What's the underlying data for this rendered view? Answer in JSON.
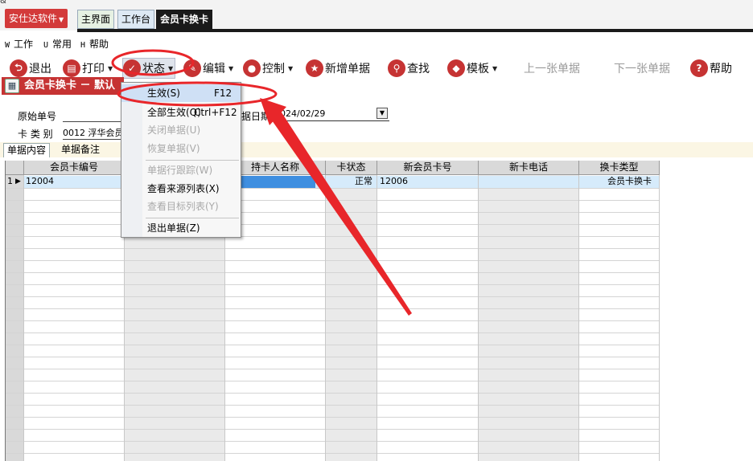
{
  "top_glyph": "&",
  "app_menu": {
    "label": "安仕达软件"
  },
  "tabs": [
    {
      "label": "主界面"
    },
    {
      "label": "工作台"
    },
    {
      "label": "会员卡换卡"
    }
  ],
  "menubar": [
    {
      "key": "W",
      "label": "工作"
    },
    {
      "key": "U",
      "label": "常用"
    },
    {
      "key": "H",
      "label": "帮助"
    }
  ],
  "toolbar": {
    "exit": "退出",
    "print": "打印",
    "status": "状态",
    "edit": "编辑",
    "control": "控制",
    "new_doc": "新增单据",
    "find": "查找",
    "template": "模板",
    "prev": "上一张单据",
    "next": "下一张单据",
    "help": "帮助"
  },
  "doc_title": "会员卡换卡 － 默认分",
  "form": {
    "origin_label": "原始单号",
    "card_type_label": "卡 类 别",
    "card_type_value": "0012 浮华会员",
    "date_label": "据日期",
    "date_value": "2024/02/29"
  },
  "subtabs": [
    {
      "label": "单据内容"
    },
    {
      "label": "单据备注"
    }
  ],
  "grid": {
    "headers": [
      "会员卡编号",
      "",
      "持卡人名称",
      "卡状态",
      "新会员卡号",
      "新卡电话",
      "换卡类型"
    ],
    "rows": [
      {
        "num": "1",
        "card_no": "12004",
        "holder": "",
        "status": "正常",
        "new_card": "12006",
        "new_phone": "",
        "type": "会员卡换卡"
      }
    ]
  },
  "dropdown": {
    "items": [
      {
        "label": "生效(S)",
        "shortcut": "F12",
        "disabled": false
      },
      {
        "label": "全部生效(Q)",
        "shortcut": "Ctrl+F12",
        "disabled": false
      },
      {
        "label": "关闭单据(U)",
        "shortcut": "",
        "disabled": true
      },
      {
        "label": "恢复单据(V)",
        "shortcut": "",
        "disabled": true
      },
      {
        "label": "单据行跟踪(W)",
        "shortcut": "",
        "disabled": true
      },
      {
        "label": "查看来源列表(X)",
        "shortcut": "",
        "disabled": false
      },
      {
        "label": "查看目标列表(Y)",
        "shortcut": "",
        "disabled": true
      },
      {
        "label": "退出单据(Z)",
        "shortcut": "",
        "disabled": false
      }
    ]
  },
  "colors": {
    "accent_red": "#c63333",
    "app_button": "#d33a3a",
    "annotation_red": "#e8262a",
    "selected_row": "#d6ebfb"
  }
}
